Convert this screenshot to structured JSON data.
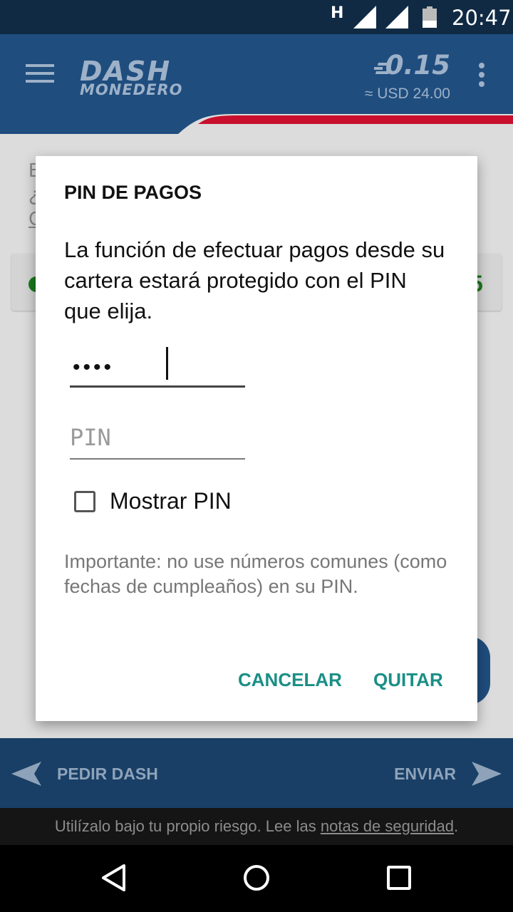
{
  "status_bar": {
    "network": "H",
    "time": "20:47"
  },
  "header": {
    "logo_top": "DASH",
    "logo_bottom": "MONEDERO",
    "balance": "0.15",
    "fiat": "≈ USD 24.00",
    "icons": [
      "menu-icon",
      "dash-symbol-icon",
      "overflow-menu-icon"
    ]
  },
  "background": {
    "text_lines": [
      "E",
      "¿",
      "C"
    ],
    "card_value": "5"
  },
  "dialog": {
    "title": "PIN DE PAGOS",
    "message": "La función de efectuar pagos desde su cartera estará protegido con el PIN que elija.",
    "pin_value": "••••",
    "pin_confirm_placeholder": "PIN",
    "show_pin_label": "Mostrar PIN",
    "show_pin_checked": false,
    "note": "Importante: no use números comunes (como fechas de cumpleaños) en su PIN.",
    "cancel_label": "CANCELAR",
    "quit_label": "QUITAR"
  },
  "bottom_bar": {
    "request_label": "PEDIR DASH",
    "send_label": "ENVIAR"
  },
  "disclaimer": {
    "text": "Utilízalo bajo tu propio riesgo. Lee las ",
    "link": "notas de seguridad",
    "end": "."
  },
  "colors": {
    "header_blue": "#1f4d7e",
    "accent_teal": "#1a8f86",
    "status_bar": "#102a44"
  }
}
